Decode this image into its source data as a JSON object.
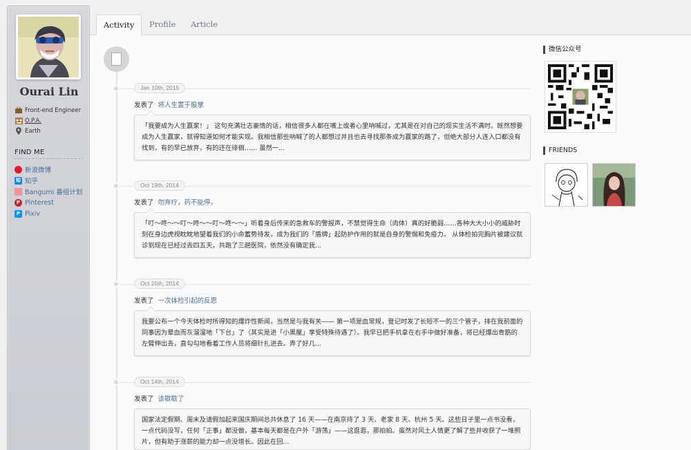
{
  "profile": {
    "name": "Ourai Lin",
    "info": [
      {
        "icon": "briefcase-icon",
        "text": "Front-end Engineer"
      },
      {
        "icon": "organization-icon",
        "text": "O.P.A."
      },
      {
        "icon": "location-pin-icon",
        "text": "Earth"
      }
    ],
    "findme_title": "FIND ME",
    "social": [
      {
        "icon": "weibo-icon",
        "label": "新浪微博",
        "color": "#e6162d"
      },
      {
        "icon": "zhihu-icon",
        "label": "知乎",
        "color": "#0f88eb"
      },
      {
        "icon": "bangumi-icon",
        "label": "Bangumi 番组计划",
        "color": "#f09199"
      },
      {
        "icon": "pinterest-icon",
        "label": "Pinterest",
        "color": "#cb2027"
      },
      {
        "icon": "pixiv-icon",
        "label": "Pixiv",
        "color": "#0096fa"
      }
    ]
  },
  "tabs": [
    {
      "label": "Activity",
      "active": true
    },
    {
      "label": "Profile",
      "active": false
    },
    {
      "label": "Article",
      "active": false
    }
  ],
  "posted_prefix": "发表了",
  "posts": [
    {
      "date": "Jan 10th, 2015",
      "title": "将人生置于股掌",
      "excerpt": "「我要成为人生赢家！」 这句充满壮志豪情的话，相信很多人都在嘴上或者心里呐喊过，尤其是在对自己的现实生活不满时。既然想要成为人生赢家，就得知道如何才能实现。我相信那些呐喊了的人都想过并且也去寻找那条成为赢家的路了，但绝大部分人连入口都没有找到，有的早已放弃，有的还在徘徊…… 虽然一..."
    },
    {
      "date": "Oct 19th, 2014",
      "title": "勿弃疗，药不能停。",
      "excerpt": "「叮～咚～～叮～咚～～叮～咚～～」听着身后传来的急救车的警报声，不禁觉得生命（肉体）真的好脆弱……各种大大小小的威胁时刻在身边虎视眈眈地望着我们的小命蓄势待发，成为我们的「盾牌」起防护作用的就是自身的警惕和免疫力。 从体检拍完胸片被建议就诊到现在已经过去四五天，共跑了三趟医院，依然没有确定我..."
    },
    {
      "date": "Oct 15th, 2014",
      "title": "一次体检引起的反思",
      "excerpt": "我要公布一个今天体检时所得知的爆炸性新闻，当然是与我有关—— 第一项是血常规，登记时发了长短不一的三个管子，排在我前面的同事因为晕血而灰溜溜地「下台」了（其实是进「小黑屋」享受特殊待遇了）。我早已把手机拿在右手中做好准备，将已经爆出青筋的左臂伸出去，直勾勾地看着工作人员将细针扎进去。弄了好几..."
    },
    {
      "date": "Oct 14th, 2014",
      "title": "该歇歇了",
      "excerpt": "国家法定假期、周末及请假加起来国庆期间总共休息了 16 天——在南京待了 3 天、老家 8 天、杭州 5 天。这些日子里一点书没看，一点代码没写，任何「正事」都没做，基本每天都是在户外「游荡」——这逛逛，那拍拍。虽然对风土人情更了解了些并收获了一堆照片，但有助于涨薪的能力却一点没增长。因此在回..."
    }
  ],
  "right": {
    "wechat_title": "微信公众号",
    "friends_title": "FRIENDS"
  }
}
